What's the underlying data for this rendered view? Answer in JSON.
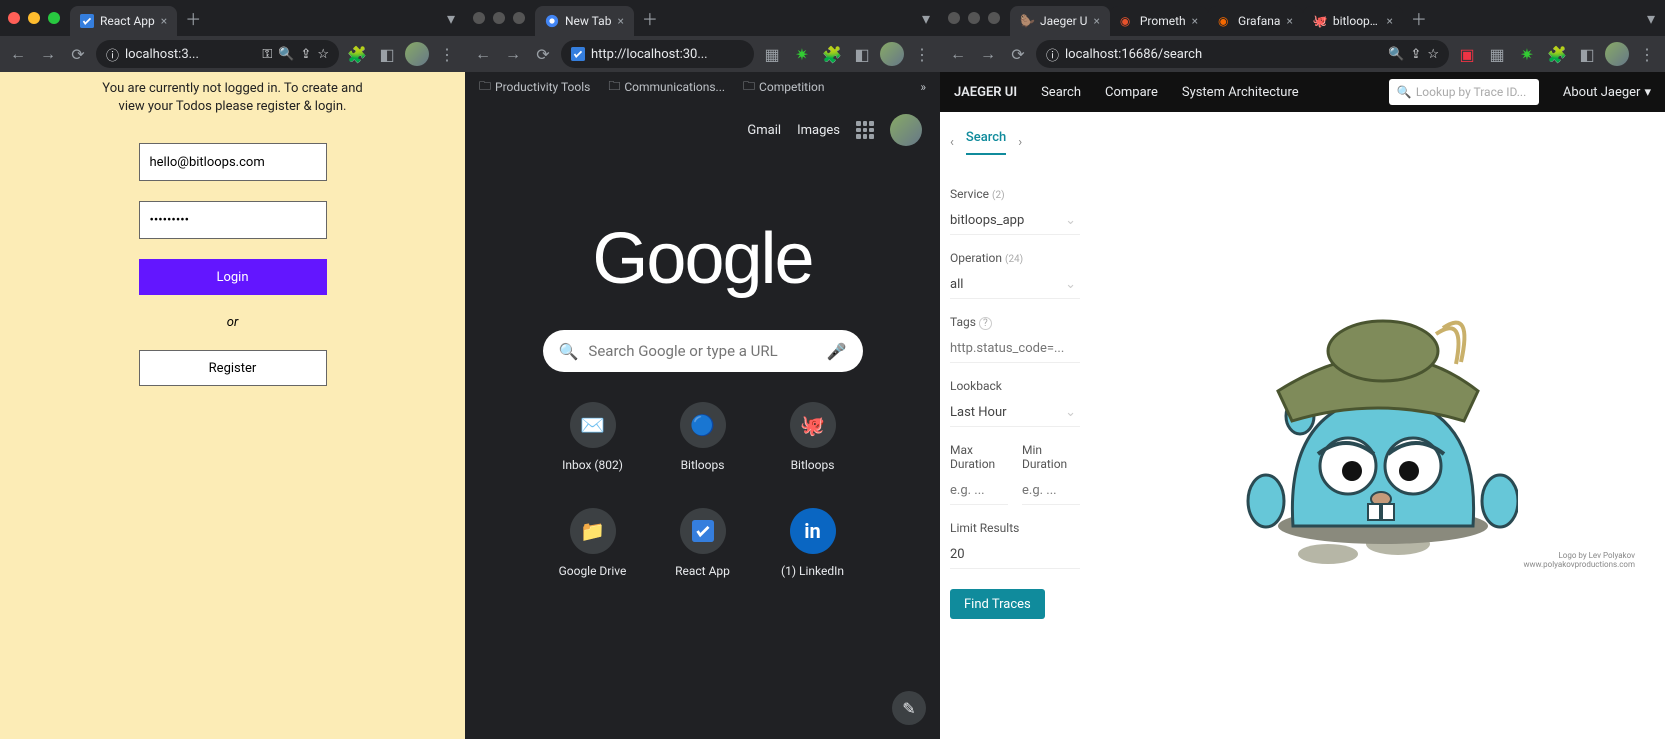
{
  "w1": {
    "tab_title": "React App",
    "url": "localhost:3...",
    "message": "You are currently not logged in. To create and view your Todos please register & login.",
    "email_value": "hello@bitloops.com",
    "password_value": "•••••••••",
    "login_label": "Login",
    "or_label": "or",
    "register_label": "Register"
  },
  "w2": {
    "tab_title": "New Tab",
    "url": "http://localhost:30...",
    "bookmarks": {
      "b1": "Productivity Tools",
      "b2": "Communications...",
      "b3": "Competition"
    },
    "header": {
      "gmail": "Gmail",
      "images": "Images"
    },
    "logo": "Google",
    "search_placeholder": "Search Google or type a URL",
    "shortcuts": {
      "s1": "Inbox (802)",
      "s2": "Bitloops",
      "s3": "Bitloops",
      "s4": "Google Drive",
      "s5": "React App",
      "s6": "(1) LinkedIn"
    }
  },
  "w3": {
    "tabs": {
      "t1": "Jaeger U",
      "t2": "Prometh",
      "t3": "Grafana",
      "t4": "bitloops/"
    },
    "url": "localhost:16686/search",
    "nav": {
      "brand": "JAEGER UI",
      "search": "Search",
      "compare": "Compare",
      "arch": "System Architecture",
      "lookup_placeholder": "Lookup by Trace ID...",
      "about": "About Jaeger"
    },
    "subtab": "Search",
    "form": {
      "service_label": "Service",
      "service_count": "(2)",
      "service_value": "bitloops_app",
      "operation_label": "Operation",
      "operation_count": "(24)",
      "operation_value": "all",
      "tags_label": "Tags",
      "tags_hint": "?",
      "tags_placeholder": "http.status_code=...",
      "lookback_label": "Lookback",
      "lookback_value": "Last Hour",
      "max_label": "Max Duration",
      "min_label": "Min Duration",
      "eg_placeholder": "e.g. ...",
      "limit_label": "Limit Results",
      "limit_value": "20",
      "find_label": "Find Traces"
    },
    "credit": "Logo by Lev Polyakov\nwww.polyakovproductions.com"
  }
}
